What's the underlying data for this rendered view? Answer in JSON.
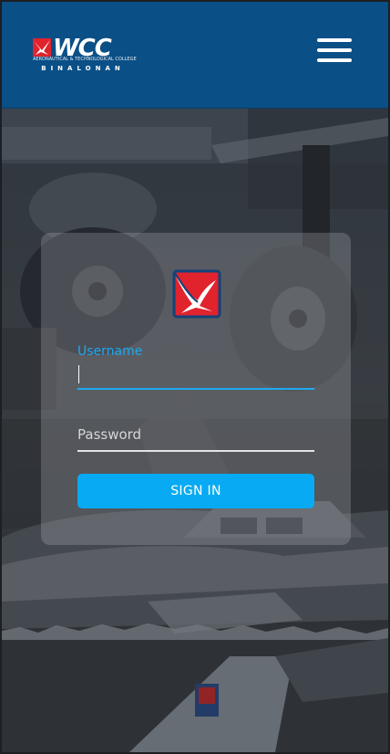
{
  "header": {
    "logo": {
      "text": "WCC",
      "subtitle": "AERONAUTICAL & TECHNOLOGICAL COLLEGE",
      "campus": "BINALONAN"
    },
    "menu_icon": "hamburger-menu-icon"
  },
  "login": {
    "username_label": "Username",
    "username_value": "",
    "password_placeholder": "Password",
    "password_value": "",
    "submit_label": "SIGN IN"
  },
  "colors": {
    "header_bg": "#0a4f86",
    "accent": "#08aaf3",
    "logo_red": "#e0232d"
  }
}
